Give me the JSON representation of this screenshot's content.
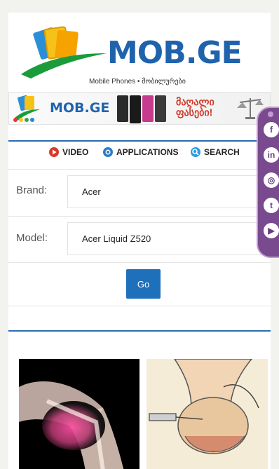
{
  "header": {
    "logo_text": "MOB.GE",
    "tagline": "Mobile Phones • მობილურები"
  },
  "banner": {
    "logo_text": "MOB.GE",
    "slogan_line1": "მაღალი",
    "slogan_line2": "ფასები!"
  },
  "nav": {
    "items": [
      {
        "label": "VIDEO",
        "icon": "play-icon",
        "color": "#d9392b"
      },
      {
        "label": "APPLICATIONS",
        "icon": "applications-icon",
        "color": "#2e7bc6"
      },
      {
        "label": "SEARCH",
        "icon": "search-icon",
        "color": "#2e9be0"
      }
    ]
  },
  "form": {
    "brand_label": "Brand:",
    "brand_value": "Acer",
    "model_label": "Model:",
    "model_value": "Acer Liquid Z520",
    "go_label": "Go"
  },
  "social": {
    "icons": [
      "facebook-icon",
      "linkedin-icon",
      "instagram-icon",
      "twitter-icon",
      "youtube-icon"
    ],
    "glyphs": [
      "f",
      "in",
      "◎",
      "t",
      "▶"
    ]
  },
  "colors": {
    "brand_blue": "#1f63ad",
    "accent_blue": "#1e70bb",
    "social_purple": "#7a4a8f"
  }
}
